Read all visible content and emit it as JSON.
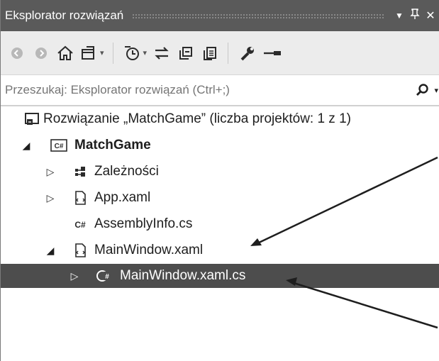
{
  "panel": {
    "title": "Eksplorator rozwiązań",
    "buttons": {
      "dropdown": "▼",
      "pin": "ꟼ",
      "close": "✕"
    }
  },
  "toolbar": {
    "items": [
      "back-icon",
      "forward-icon",
      "home-icon",
      "sync-view-icon",
      "pending-changes-icon",
      "refresh-icon",
      "collapse-all-icon",
      "show-all-files-icon",
      "properties-icon",
      "preview-icon"
    ]
  },
  "search": {
    "placeholder": "Przeszukaj: Eksplorator rozwiązań (Ctrl+;)"
  },
  "tree": {
    "solution": "Rozwiązanie „MatchGame” (liczba projektów: 1 z 1)",
    "project": "MatchGame",
    "project_badge": "C#",
    "dependencies": "Zależności",
    "app_xaml": "App.xaml",
    "assemblyinfo": "AssemblyInfo.cs",
    "mainwindow_xaml": "MainWindow.xaml",
    "mainwindow_cs": "MainWindow.xaml.cs",
    "cs_badge": "C#"
  },
  "colors": {
    "titlebar": "#5a5a5a",
    "toolbar": "#ececec",
    "selection": "#4d4d4d"
  }
}
